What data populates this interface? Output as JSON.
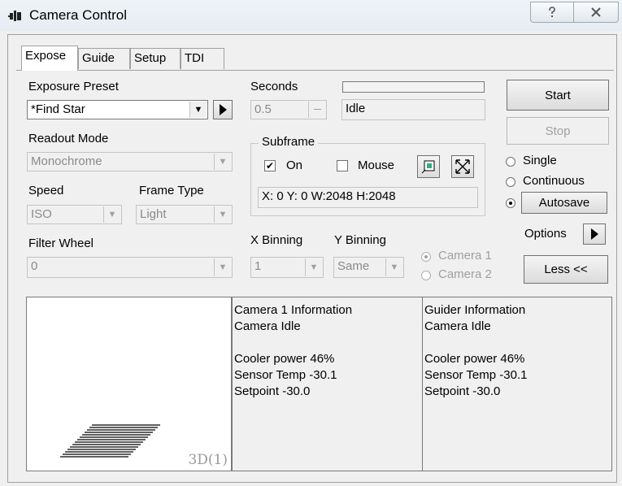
{
  "window": {
    "title": "Camera Control"
  },
  "tabs": [
    "Expose",
    "Guide",
    "Setup",
    "TDI"
  ],
  "exposure": {
    "preset_label": "Exposure Preset",
    "preset_value": "*Find Star",
    "seconds_label": "Seconds",
    "seconds_value": "0.5",
    "status": "Idle",
    "progress": 0
  },
  "readout": {
    "label": "Readout Mode",
    "value": "Monochrome"
  },
  "speed": {
    "label": "Speed",
    "value": "ISO"
  },
  "frame_type": {
    "label": "Frame Type",
    "value": "Light"
  },
  "filter_wheel": {
    "label": "Filter Wheel",
    "value": "0"
  },
  "subframe": {
    "label": "Subframe",
    "on_label": "On",
    "on_checked": true,
    "mouse_label": "Mouse",
    "mouse_checked": false,
    "coords": "X:  0 Y:  0 W:2048 H:2048"
  },
  "binning": {
    "x_label": "X Binning",
    "x_value": "1",
    "y_label": "Y Binning",
    "y_value": "Same"
  },
  "camera_select": {
    "camera1": "Camera 1",
    "camera2": "Camera 2",
    "selected": "Camera 1"
  },
  "buttons": {
    "start": "Start",
    "stop": "Stop",
    "autosave": "Autosave",
    "options": "Options",
    "less": "Less <<"
  },
  "mode": {
    "single": "Single",
    "continuous": "Continuous",
    "selected": "Autosave"
  },
  "preview": {
    "label": "3D(1)"
  },
  "camera1_info": {
    "title": "Camera 1 Information",
    "status": "Camera Idle",
    "cooler": "Cooler power 46%",
    "sensor_temp": "Sensor Temp -30.1",
    "setpoint": "Setpoint -30.0"
  },
  "guider_info": {
    "title": "Guider Information",
    "status": "Camera Idle",
    "cooler": "Cooler power 46%",
    "sensor_temp": "Sensor Temp -30.1",
    "setpoint": "Setpoint -30.0"
  }
}
